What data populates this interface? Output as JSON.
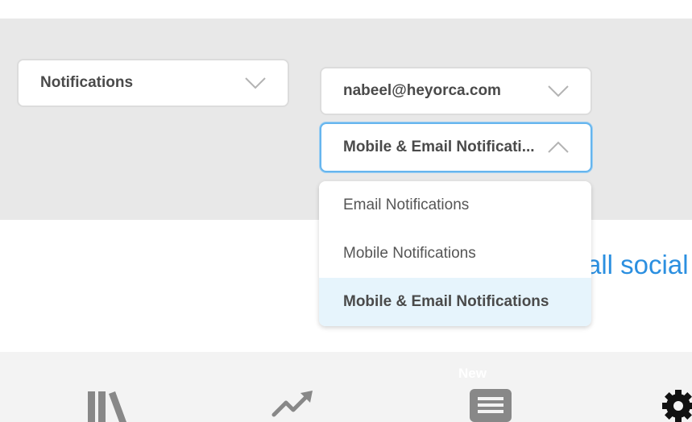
{
  "filters": {
    "category": {
      "value": "Notifications"
    },
    "account": {
      "value": "nabeel@heyorca.com"
    },
    "notification_type": {
      "value": "Mobile & Email Notificati...",
      "options": [
        "Email Notifications",
        "Mobile Notifications",
        "Mobile & Email Notifications"
      ],
      "selected": "Mobile & Email Notifications"
    }
  },
  "content": {
    "social_link_text": "all social"
  },
  "bottom_nav": {
    "items": [
      {
        "icon": "library-icon"
      },
      {
        "icon": "trending-icon"
      },
      {
        "icon": "posts-icon",
        "badge": "New"
      },
      {
        "icon": "gear-icon"
      }
    ]
  },
  "colors": {
    "band": "#e8e8e8",
    "focus_border": "#66b5ee",
    "selected_option_bg": "#e6f4fc",
    "link": "#2b8fe0",
    "icon_gray": "#888888"
  }
}
